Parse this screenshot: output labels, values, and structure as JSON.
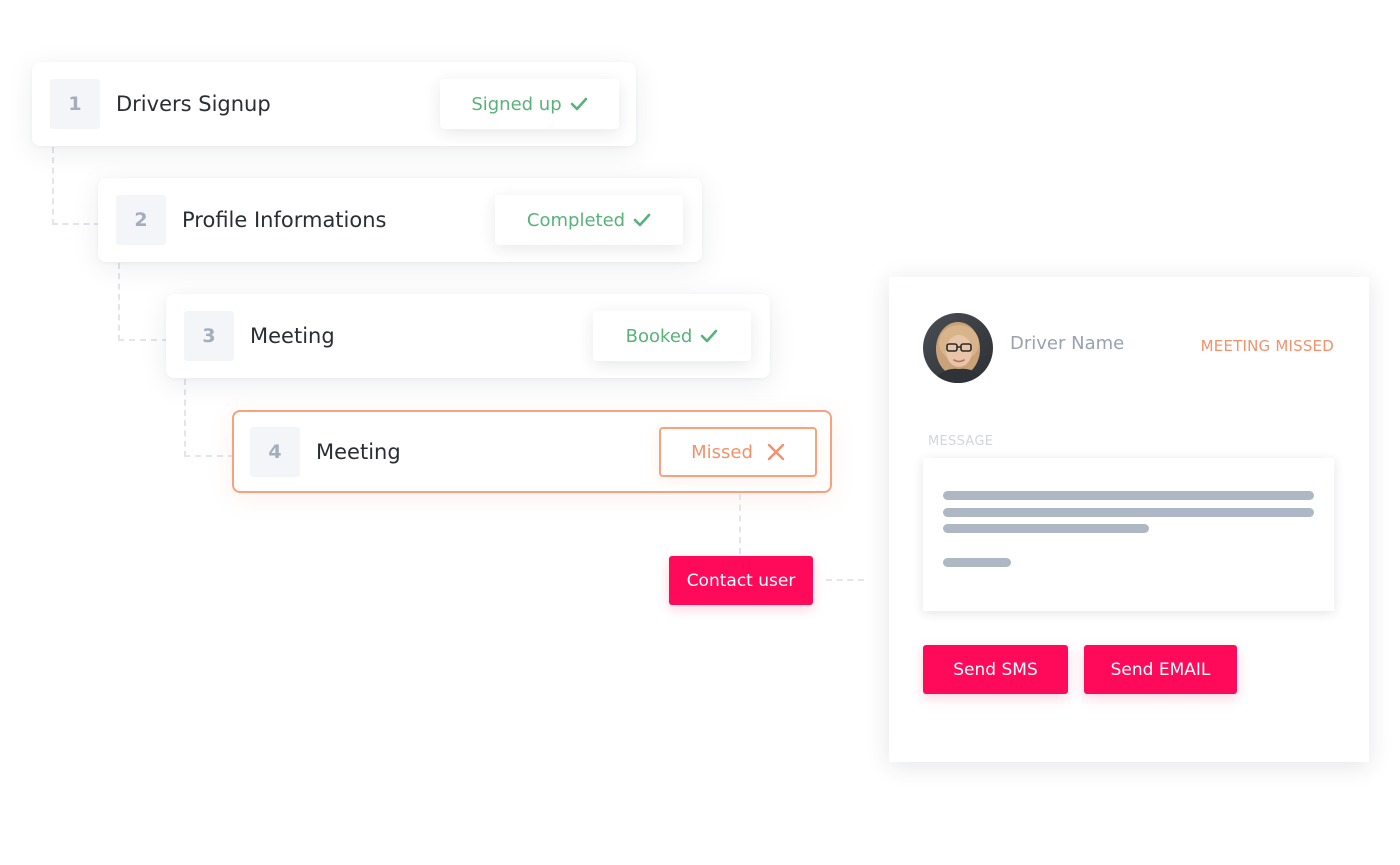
{
  "steps": [
    {
      "number": "1",
      "title": "Drivers Signup",
      "status": "Signed up",
      "status_icon": "check-icon"
    },
    {
      "number": "2",
      "title": "Profile Informations",
      "status": "Completed",
      "status_icon": "check-icon"
    },
    {
      "number": "3",
      "title": "Meeting",
      "status": "Booked",
      "status_icon": "check-icon"
    },
    {
      "number": "4",
      "title": "Meeting",
      "status": "Missed",
      "status_icon": "close-icon"
    }
  ],
  "contact_button": "Contact user",
  "driver_panel": {
    "driver_name": "Driver Name",
    "status_label": "MEETING MISSED",
    "message_label": "MESSAGE",
    "send_sms": "Send SMS",
    "send_email": "Send EMAIL"
  },
  "colors": {
    "success": "#57b37a",
    "missed": "#f5906a",
    "primary": "#ff0a5a",
    "placeholder_line": "#aeb8c5"
  }
}
